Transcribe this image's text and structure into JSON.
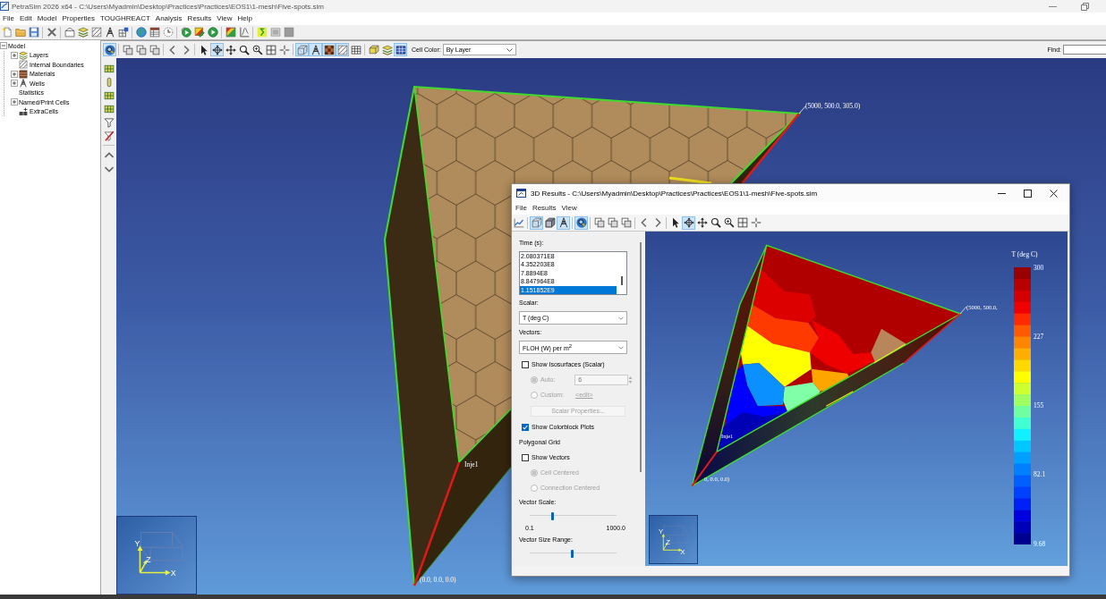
{
  "window": {
    "title": "PetraSim 2026 x64 - C:\\Users\\Myadmin\\Desktop\\Practices\\Practices\\EOS1\\1-mesh\\Five-spots.sim"
  },
  "menu": [
    "File",
    "Edit",
    "Model",
    "Properties",
    "TOUGHREACT",
    "Analysis",
    "Results",
    "View",
    "Help"
  ],
  "main_toolbar": [
    {
      "kind": "new-file"
    },
    {
      "kind": "folder"
    },
    {
      "kind": "save"
    },
    {
      "kind": "separator"
    },
    {
      "kind": "delete"
    },
    {
      "kind": "separator"
    },
    {
      "kind": "pentagon"
    },
    {
      "kind": "layers"
    },
    {
      "kind": "hatch"
    },
    {
      "kind": "derrick"
    },
    {
      "kind": "cells"
    },
    {
      "kind": "separator"
    },
    {
      "kind": "globe"
    },
    {
      "kind": "table"
    },
    {
      "kind": "clock"
    },
    {
      "kind": "separator"
    },
    {
      "kind": "run"
    },
    {
      "kind": "pencil-square"
    },
    {
      "kind": "play"
    },
    {
      "kind": "separator"
    },
    {
      "kind": "color-square"
    },
    {
      "kind": "plot"
    },
    {
      "kind": "separator"
    },
    {
      "kind": "zigzag"
    },
    {
      "kind": "image"
    },
    {
      "kind": "blank-tile"
    }
  ],
  "tree": [
    {
      "label": "Model",
      "kind": "plain",
      "expanded": true,
      "children": [
        {
          "label": "Layers",
          "kind": "layers",
          "expanded": false
        },
        {
          "label": "Internal Boundaries",
          "kind": "hatch"
        },
        {
          "label": "Materials",
          "kind": "material",
          "expanded": false
        },
        {
          "label": "Wells",
          "kind": "derrick",
          "expanded": false
        },
        {
          "label": "Statistics",
          "kind": "plain"
        },
        {
          "label": "Named/Print Cells",
          "kind": "plain",
          "expanded": false
        },
        {
          "label": "ExtraCells",
          "kind": "cells-plus"
        }
      ]
    }
  ],
  "view_toolbar": {
    "buttons": [
      {
        "kind": "magnifier",
        "on": true
      },
      {
        "kind": "separator"
      },
      {
        "kind": "squares",
        "on": false
      },
      {
        "kind": "squares",
        "on": false
      },
      {
        "kind": "squares",
        "on": false
      },
      {
        "kind": "separator"
      },
      {
        "kind": "chevron-left",
        "on": false
      },
      {
        "kind": "chevron-right",
        "on": false
      },
      {
        "kind": "separator"
      },
      {
        "kind": "pointer",
        "on": false
      },
      {
        "kind": "rotate",
        "on": true
      },
      {
        "kind": "move",
        "on": false
      },
      {
        "kind": "zoom",
        "on": false
      },
      {
        "kind": "zoom-plus",
        "on": false
      },
      {
        "kind": "frame",
        "on": false
      },
      {
        "kind": "crosshair",
        "on": false
      },
      {
        "kind": "separator"
      },
      {
        "kind": "wireframe",
        "on": true
      },
      {
        "kind": "derrick",
        "on": true
      },
      {
        "kind": "checker",
        "on": true
      },
      {
        "kind": "hatch",
        "on": true
      },
      {
        "kind": "grid",
        "on": false
      },
      {
        "kind": "separator"
      },
      {
        "kind": "block",
        "on": false
      },
      {
        "kind": "layers",
        "on": false
      },
      {
        "kind": "filled-grid",
        "on": true
      }
    ],
    "cell_color": {
      "label": "Cell Color:",
      "value": "By Layer"
    },
    "find": {
      "label": "Find:"
    }
  },
  "side_toolbar": [
    {
      "kind": "grid-cells"
    },
    {
      "kind": "pill"
    },
    {
      "kind": "grid-cells"
    },
    {
      "kind": "grid-cells"
    },
    {
      "kind": "filter"
    },
    {
      "kind": "filter-off"
    },
    {
      "kind": "separator"
    },
    {
      "kind": "chevron-up"
    },
    {
      "kind": "chevron-down"
    }
  ],
  "viewport": {
    "far_corner_label": "(5000, 500.0, 305.0)",
    "well_label": "Inje1",
    "origin_label": "(0.0, 0.0, 0.0)",
    "axis_labels": [
      "Y",
      "Z",
      "X"
    ]
  },
  "results_window": {
    "title": "3D Results - C:\\Users\\Myadmin\\Desktop\\Practices\\Practices\\EOS1\\1-mesh\\Five-spots.sim",
    "menu": [
      "File",
      "Results",
      "View"
    ],
    "toolbar": [
      {
        "kind": "line-chart",
        "on": false
      },
      {
        "kind": "separator"
      },
      {
        "kind": "wireframe",
        "on": true
      },
      {
        "kind": "cube",
        "on": false
      },
      {
        "kind": "derrick",
        "on": true
      },
      {
        "kind": "separator"
      },
      {
        "kind": "magnifier",
        "on": true
      },
      {
        "kind": "separator"
      },
      {
        "kind": "squares",
        "on": false
      },
      {
        "kind": "squares",
        "on": false
      },
      {
        "kind": "squares",
        "on": false
      },
      {
        "kind": "separator"
      },
      {
        "kind": "chevron-left",
        "on": false
      },
      {
        "kind": "chevron-right",
        "on": false
      },
      {
        "kind": "separator"
      },
      {
        "kind": "pointer",
        "on": false
      },
      {
        "kind": "rotate",
        "on": true
      },
      {
        "kind": "move",
        "on": false
      },
      {
        "kind": "zoom",
        "on": false
      },
      {
        "kind": "zoom-plus",
        "on": false
      },
      {
        "kind": "frame",
        "on": false
      },
      {
        "kind": "crosshair",
        "on": false
      }
    ],
    "panel": {
      "time": {
        "label": "Time (s):",
        "items": [
          {
            "text": "2.080371E8",
            "selected": false
          },
          {
            "text": "4.352203E8",
            "selected": false
          },
          {
            "text": "7.8894E8",
            "selected": false
          },
          {
            "text": "8.847964E8",
            "selected": false
          },
          {
            "text": "1.151852E9",
            "selected": true
          }
        ]
      },
      "scalar": {
        "label": "Scalar:",
        "value": "T (deg C)"
      },
      "vectors": {
        "label": "Vectors:",
        "value": "FLOH (W) per m$^{2}$"
      },
      "controls": [
        {
          "kind": "checkbox",
          "label": "Show Isosurfaces (Scalar)",
          "checked": false,
          "disabled": false
        },
        {
          "kind": "radio-field",
          "label": "Auto:",
          "selected": true,
          "disabled": true,
          "value": "6"
        },
        {
          "kind": "radio-link",
          "label": "Custom:",
          "selected": false,
          "disabled": true,
          "link": "<edit>"
        },
        {
          "kind": "button",
          "label": "Scalar Properties...",
          "disabled": true
        },
        {
          "kind": "checkbox",
          "label": "Show Colorblock Plots",
          "checked": true,
          "disabled": false
        },
        {
          "kind": "heading",
          "label": "Polygonal Grid"
        },
        {
          "kind": "checkbox",
          "label": "Show Vectors",
          "checked": false,
          "disabled": false
        },
        {
          "kind": "radio",
          "label": "Cell Centered",
          "selected": true,
          "disabled": true
        },
        {
          "kind": "radio",
          "label": "Connection Centered",
          "selected": false,
          "disabled": true
        },
        {
          "kind": "slider",
          "label": "Vector Scale:",
          "level": 0.26,
          "min_label": "0.1",
          "max_label": "1000.0"
        },
        {
          "kind": "slider",
          "label": "Vector Size Range:",
          "level": 0.49
        }
      ]
    },
    "legend": {
      "title": "T (deg C)",
      "ticks": [
        "300",
        "227",
        "155",
        "82.1",
        "9.68"
      ]
    },
    "far_corner_label": "(5000, 500.0,",
    "well_label": "Inje1",
    "origin_label": "0, 0.0, 0.0)",
    "axis_labels": [
      "Y",
      "Z",
      "X"
    ]
  }
}
